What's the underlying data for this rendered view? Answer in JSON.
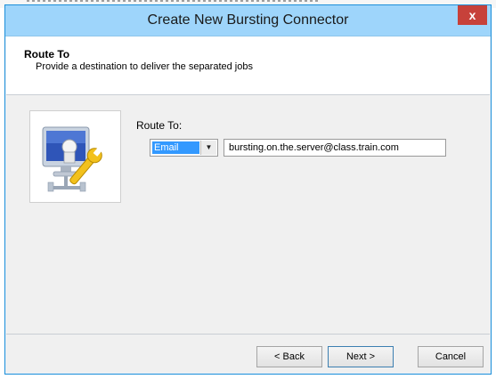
{
  "window": {
    "title": "Create New Bursting Connector",
    "close_glyph": "x"
  },
  "header": {
    "title": "Route To",
    "subtitle": "Provide a destination to deliver the separated jobs"
  },
  "form": {
    "route_label": "Route To:",
    "route_type_selected": "Email",
    "destination_value": "bursting.on.the.server@class.train.com",
    "wizard_icon": "computer-network-wrench-icon"
  },
  "buttons": {
    "back": "< Back",
    "next": "Next >",
    "cancel": "Cancel"
  },
  "colors": {
    "title_bar": "#9ed5fb",
    "window_border": "#1b8fd9",
    "close_button": "#c7413a",
    "selection": "#3399ff"
  }
}
